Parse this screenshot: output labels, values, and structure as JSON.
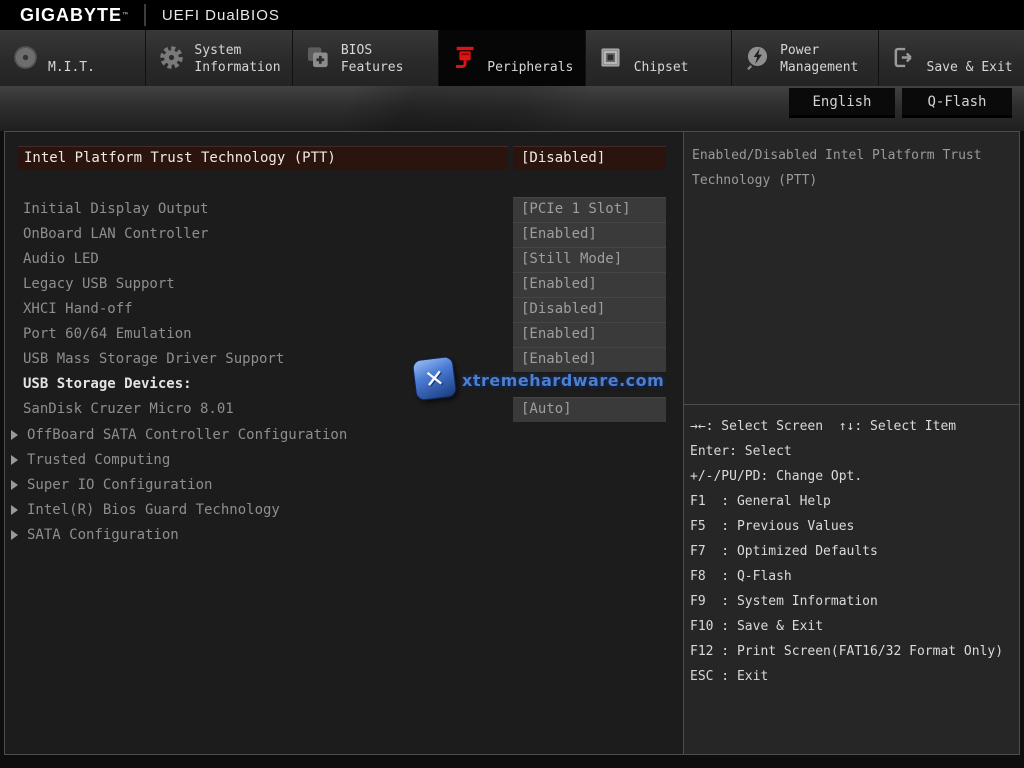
{
  "header": {
    "brand": "GIGABYTE",
    "brand_tm": "™",
    "title": "UEFI DualBIOS"
  },
  "tabs": [
    {
      "label": "M.I.T.",
      "icon": "mit-icon",
      "selected": false
    },
    {
      "label": "System Information",
      "icon": "system-information-icon",
      "selected": false
    },
    {
      "label": "BIOS Features",
      "icon": "bios-features-icon",
      "selected": false
    },
    {
      "label": "Peripherals",
      "icon": "peripherals-icon",
      "selected": true
    },
    {
      "label": "Chipset",
      "icon": "chipset-icon",
      "selected": false
    },
    {
      "label": "Power Management",
      "icon": "power-management-icon",
      "selected": false
    },
    {
      "label": "Save & Exit",
      "icon": "save-exit-icon",
      "selected": false
    }
  ],
  "toolbar": {
    "language_button": "English",
    "qflash_button": "Q-Flash"
  },
  "list": {
    "selected": {
      "label": "Intel Platform Trust Technology (PTT)",
      "value": "[Disabled]"
    },
    "rows": [
      {
        "label": "Initial Display Output",
        "value": "[PCIe 1 Slot]"
      },
      {
        "label": "OnBoard LAN Controller",
        "value": "[Enabled]"
      },
      {
        "label": "Audio LED",
        "value": "[Still Mode]"
      },
      {
        "label": "Legacy USB Support",
        "value": "[Enabled]"
      },
      {
        "label": "XHCI Hand-off",
        "value": "[Disabled]"
      },
      {
        "label": "Port 60/64 Emulation",
        "value": "[Enabled]"
      },
      {
        "label": "USB Mass Storage Driver Support",
        "value": "[Enabled]"
      }
    ],
    "section_label": "USB Storage Devices:",
    "device": {
      "label": "SanDisk Cruzer Micro 8.01",
      "value": "[Auto]"
    },
    "submenus": [
      "OffBoard SATA Controller Configuration",
      "Trusted Computing",
      "Super IO Configuration",
      "Intel(R) Bios Guard Technology",
      "SATA Configuration"
    ]
  },
  "help": {
    "description": "Enabled/Disabled Intel Platform Trust Technology (PTT)"
  },
  "keys": [
    "→←: Select Screen  ↑↓: Select Item",
    "Enter: Select",
    "+/-/PU/PD: Change Opt.",
    "F1  : General Help",
    "F5  : Previous Values",
    "F7  : Optimized Defaults",
    "F8  : Q-Flash",
    "F9  : System Information",
    "F10 : Save & Exit",
    "F12 : Print Screen(FAT16/32 Format Only)",
    "ESC : Exit"
  ],
  "watermark": {
    "text": "xtremehardware.com"
  },
  "colors": {
    "accent_red": "#e01313",
    "highlight_bg": "#2b140e",
    "value_box_bg": "#3a3a3a",
    "watermark_blue": "#4d7fd0",
    "panel_border": "#4d4d4d"
  }
}
